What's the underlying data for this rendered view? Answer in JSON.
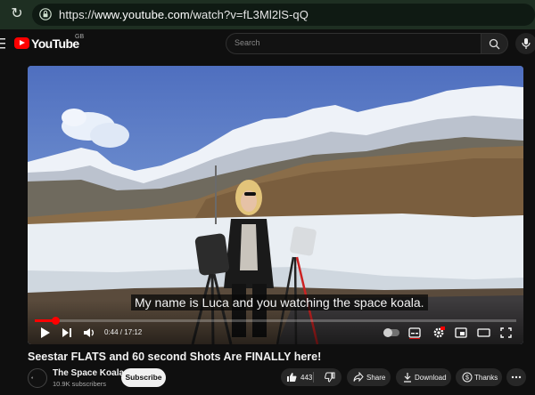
{
  "browser": {
    "url_prefix": "https://",
    "url_host": "www.youtube.com",
    "url_path": "/watch?v=fL3Ml2lS-qQ"
  },
  "header": {
    "logo_text": "YouTube",
    "country_code": "GB",
    "search_placeholder": "Search"
  },
  "player": {
    "caption": "My name is Luca and you watching the space koala.",
    "time_display": "0:44 / 17:12",
    "progress_fraction": 0.0426
  },
  "video": {
    "title": "Seestar FLATS and 60 second Shots Are FINALLY here!"
  },
  "channel": {
    "name": "The Space Koala",
    "subscribers": "10.9K subscribers",
    "subscribe_label": "Subscribe"
  },
  "actions": {
    "like_count": "443",
    "share_label": "Share",
    "download_label": "Download",
    "thanks_label": "Thanks"
  },
  "colors": {
    "accent": "#ff0000",
    "browser_bar": "#1e2f22",
    "page_bg": "#0f0f0f"
  },
  "icons": [
    "reload-icon",
    "lock-icon",
    "menu-icon",
    "search-icon",
    "mic-icon",
    "play-icon",
    "next-icon",
    "volume-icon",
    "captions-icon",
    "settings-icon",
    "miniplayer-icon",
    "theater-icon",
    "fullscreen-icon",
    "like-icon",
    "dislike-icon",
    "share-icon",
    "download-icon",
    "thanks-icon",
    "more-icon"
  ]
}
